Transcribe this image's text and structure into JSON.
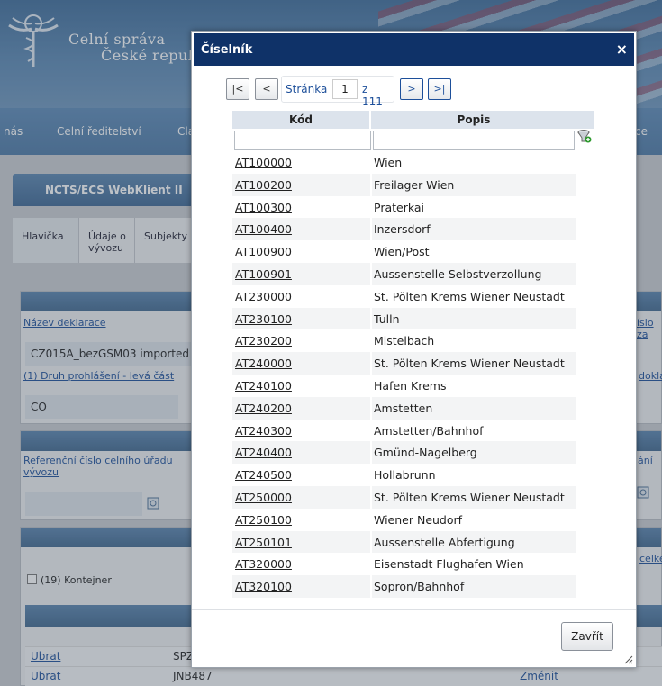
{
  "header": {
    "org_line1": "Celní správa",
    "org_line2": "České repub"
  },
  "nav": {
    "items": [
      "nás",
      "Celní ředitelství",
      "Cla",
      "ce"
    ]
  },
  "app": {
    "title": "NCTS/ECS WebKlient II",
    "tabs": [
      {
        "label": "Hlavička"
      },
      {
        "label": "Údaje o vývozu"
      },
      {
        "label": "Subjekty"
      }
    ],
    "fields": {
      "nazev_link": "Název deklarace",
      "nazev_value": "CZ015A_bezGSM03 imported",
      "druh_link": "(1) Druh prohlášení - levá část",
      "druh_value": "CO",
      "ref_link": "Referenční číslo celního úřadu vývozu",
      "kontejner_label": "(19) Kontejner",
      "right_cislo": "íslo za",
      "right_dokla": "dokla",
      "right_ani": "ání",
      "right_celke": "celke",
      "row1_action": "Ubrat",
      "row1_value": "SPZ",
      "row2_action": "Ubrat",
      "row2_value": "JNB487",
      "row2_change": "Změnit"
    }
  },
  "dialog": {
    "title": "Číselník",
    "pager": {
      "first": "|<",
      "prev": "<",
      "page_label": "Stránka",
      "page_value": "1",
      "of_label": "z 111",
      "next": ">",
      "last": ">|"
    },
    "columns": {
      "code": "Kód",
      "desc": "Popis"
    },
    "filter": {
      "code": "",
      "desc": ""
    },
    "rows": [
      {
        "code": "AT100000",
        "desc": "Wien"
      },
      {
        "code": "AT100200",
        "desc": "Freilager Wien"
      },
      {
        "code": "AT100300",
        "desc": "Praterkai"
      },
      {
        "code": "AT100400",
        "desc": "Inzersdorf"
      },
      {
        "code": "AT100900",
        "desc": "Wien/Post"
      },
      {
        "code": "AT100901",
        "desc": "Aussenstelle Selbstverzollung"
      },
      {
        "code": "AT230000",
        "desc": "St. Pölten Krems Wiener Neustadt"
      },
      {
        "code": "AT230100",
        "desc": "Tulln"
      },
      {
        "code": "AT230200",
        "desc": "Mistelbach"
      },
      {
        "code": "AT240000",
        "desc": "St. Pölten Krems Wiener Neustadt"
      },
      {
        "code": "AT240100",
        "desc": "Hafen Krems"
      },
      {
        "code": "AT240200",
        "desc": "Amstetten"
      },
      {
        "code": "AT240300",
        "desc": "Amstetten/Bahnhof"
      },
      {
        "code": "AT240400",
        "desc": "Gmünd-Nagelberg"
      },
      {
        "code": "AT240500",
        "desc": "Hollabrunn"
      },
      {
        "code": "AT250000",
        "desc": "St. Pölten Krems Wiener Neustadt"
      },
      {
        "code": "AT250100",
        "desc": "Wiener Neudorf"
      },
      {
        "code": "AT250101",
        "desc": "Aussenstelle Abfertigung"
      },
      {
        "code": "AT320000",
        "desc": "Eisenstadt Flughafen Wien"
      },
      {
        "code": "AT320100",
        "desc": "Sopron/Bahnhof"
      }
    ],
    "close_button": "Zavřít",
    "close_icon": "×"
  }
}
